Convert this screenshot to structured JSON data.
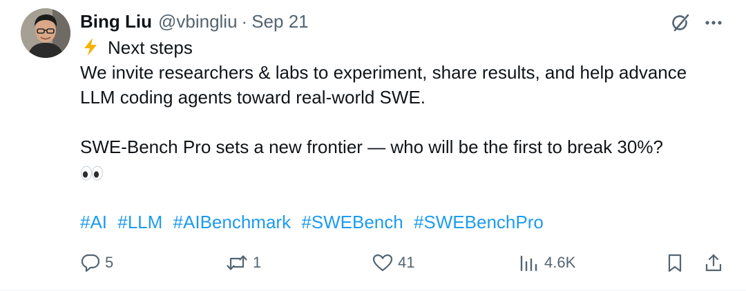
{
  "post": {
    "author": {
      "name": "Bing Liu",
      "handle": "@vbingliu",
      "separator": "·",
      "date": "Sep 21"
    },
    "content": {
      "heading": "Next steps",
      "paragraph1_line1": "We invite researchers & labs to experiment, share results, and help advance",
      "paragraph1_line2": "LLM coding agents toward real-world SWE.",
      "paragraph2": "SWE-Bench Pro sets a new frontier — who will be the first to break 30%?",
      "hashtags": [
        "#AI",
        "#LLM",
        "#AIBenchmark",
        "#SWEBench",
        "#SWEBenchPro"
      ]
    },
    "actions": {
      "replies": "5",
      "reposts": "1",
      "likes": "41",
      "views": "4.6K"
    }
  },
  "icons": {
    "heading_emoji": "lightning-bolt-icon",
    "trailing_emoji": "eyes-icon",
    "header_buttons": [
      "grok-icon",
      "more-icon"
    ],
    "action_icons": [
      "reply-icon",
      "repost-icon",
      "like-icon",
      "views-icon",
      "bookmark-icon",
      "share-icon"
    ]
  },
  "colors": {
    "text": "#0f1419",
    "secondary": "#536471",
    "link": "#1d9bf0",
    "bolt": "#f4b400"
  }
}
